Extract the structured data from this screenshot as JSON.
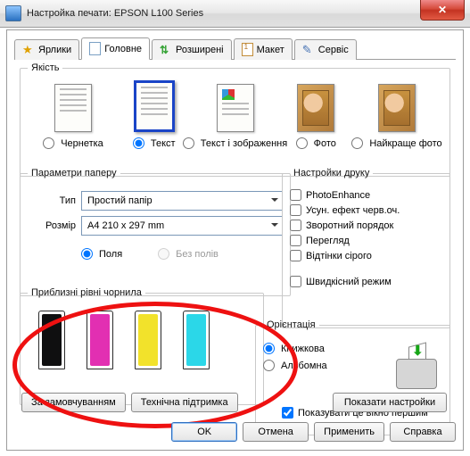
{
  "window": {
    "title": "Настройка печати: EPSON L100 Series",
    "close_glyph": "✕"
  },
  "tabs": {
    "shortcuts": "Ярлики",
    "main": "Головне",
    "advanced": "Розширені",
    "layout": "Макет",
    "service": "Сервіс"
  },
  "quality": {
    "legend": "Якість",
    "draft": "Чернетка",
    "text": "Текст",
    "text_image": "Текст і зображення",
    "photo": "Фото",
    "best_photo": "Найкраще фото",
    "selected": "text"
  },
  "paper": {
    "legend": "Параметри паперу",
    "type_label": "Тип",
    "type_value": "Простий папір",
    "size_label": "Розмір",
    "size_value": "A4 210 x 297 mm",
    "margins": "Поля",
    "borderless": "Без полів"
  },
  "print": {
    "legend": "Настройки друку",
    "photoenhance": "PhotoEnhance",
    "redeye": "Усун. ефект черв.оч.",
    "reverse": "Зворотний порядок",
    "preview": "Перегляд",
    "grayscale": "Відтінки сірого",
    "fast": "Швидкісний режим"
  },
  "ink": {
    "legend": "Приблизні рівні чорнила",
    "inks": [
      {
        "name": "black",
        "level": 100
      },
      {
        "name": "magenta",
        "level": 100
      },
      {
        "name": "yellow",
        "level": 100
      },
      {
        "name": "cyan",
        "level": 100
      }
    ]
  },
  "orientation": {
    "legend": "Орієнтація",
    "portrait": "Книжкова",
    "landscape": "Альбомна"
  },
  "show_first": "Показувати це вікно першим",
  "buttons": {
    "defaults": "За замовчуванням",
    "support": "Технічна підтримка",
    "show_settings": "Показати настройки",
    "ok": "OK",
    "cancel": "Отмена",
    "apply": "Применить",
    "help": "Справка"
  }
}
